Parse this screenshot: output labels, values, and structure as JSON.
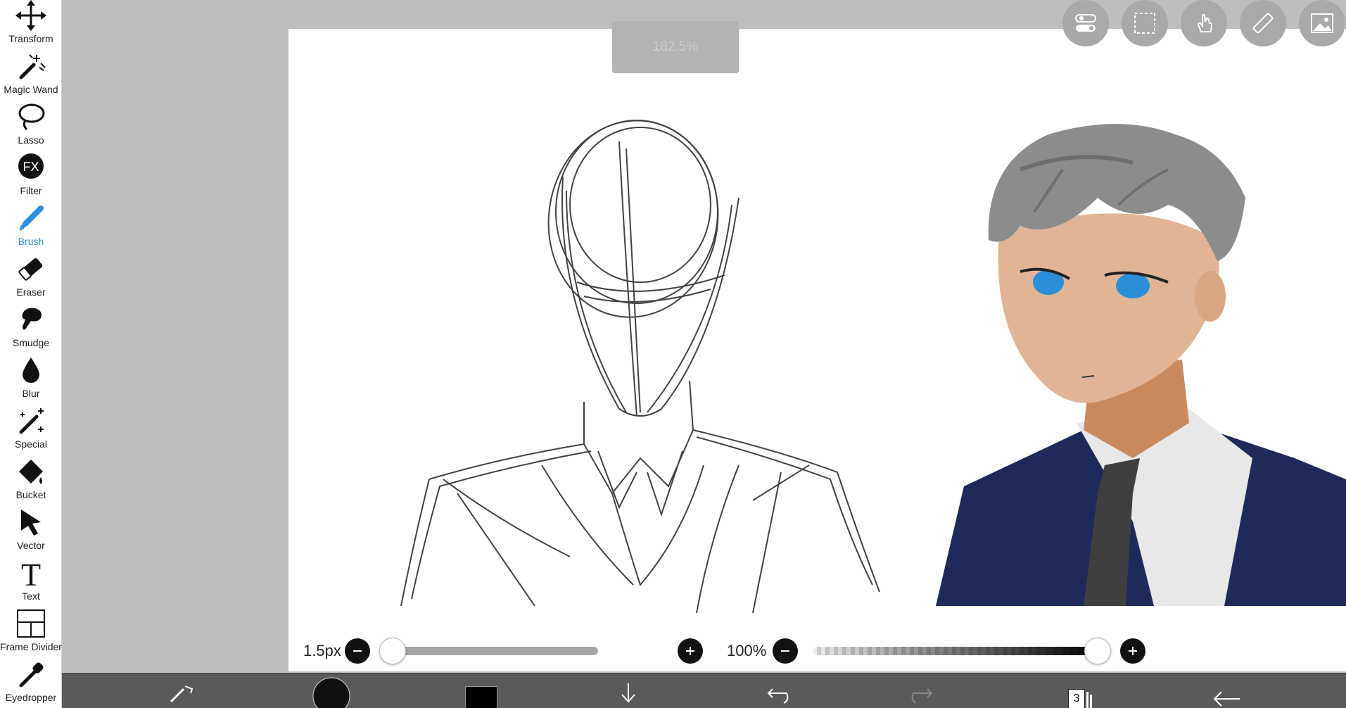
{
  "toolbar": {
    "tools": [
      {
        "label": "Transform",
        "icon": "move-arrows-icon"
      },
      {
        "label": "Magic Wand",
        "icon": "magic-wand-icon"
      },
      {
        "label": "Lasso",
        "icon": "lasso-icon"
      },
      {
        "label": "Filter",
        "icon": "fx-icon"
      },
      {
        "label": "Brush",
        "icon": "brush-icon"
      },
      {
        "label": "Eraser",
        "icon": "eraser-icon"
      },
      {
        "label": "Smudge",
        "icon": "smudge-icon"
      },
      {
        "label": "Blur",
        "icon": "drop-icon"
      },
      {
        "label": "Special",
        "icon": "sparkle-pen-icon"
      },
      {
        "label": "Bucket",
        "icon": "bucket-icon"
      },
      {
        "label": "Vector",
        "icon": "cursor-arrow-icon"
      },
      {
        "label": "Text",
        "icon": "text-t-icon"
      },
      {
        "label": "Frame Divider",
        "icon": "frame-divider-icon"
      },
      {
        "label": "Eyedropper",
        "icon": "eyedropper-icon"
      }
    ],
    "active_tool": "Brush",
    "active_color": "#2a8fe0"
  },
  "canvas": {
    "zoom_label": "182.5%"
  },
  "top_buttons": [
    "toggle-panel-icon",
    "selection-icon",
    "hand-touch-icon",
    "ruler-icon",
    "image-icon"
  ],
  "brush_controls": {
    "size_label": "1.5px",
    "size_fraction": 0.01,
    "opacity_label": "100%",
    "opacity_fraction": 1.0
  },
  "bottom_bar": {
    "layer_count": "3",
    "primary_color": "#000000",
    "icons": [
      "pen-swap-icon",
      "brush-preview-icon",
      "color-swatch-icon",
      "download-icon",
      "undo-icon",
      "redo-icon",
      "layers-icon",
      "back-arrow-icon"
    ]
  }
}
